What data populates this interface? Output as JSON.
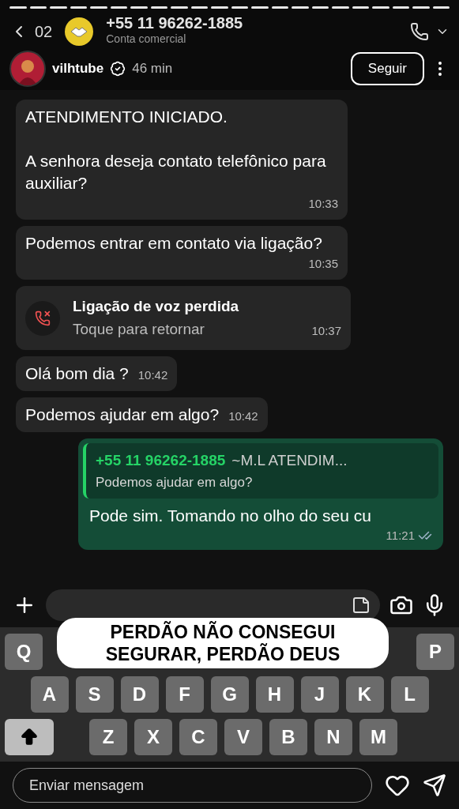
{
  "story": {
    "username": "vilhtube",
    "verified": true,
    "time": "46 min",
    "follow_button": "Seguir",
    "caption": "PERDÃO NÃO CONSEGUI SEGURAR, PERDÃO DEUS",
    "reply_placeholder": "Enviar mensagem"
  },
  "chat_header": {
    "back_count": "02",
    "title": "+55 11 96262-1885",
    "subtitle": "Conta comercial"
  },
  "messages": [
    {
      "kind": "text",
      "outgoing": false,
      "text": "ATENDIMENTO INICIADO.\n\nA senhora deseja contato telefônico para auxiliar?",
      "time": "10:33"
    },
    {
      "kind": "text",
      "outgoing": false,
      "text": "Podemos entrar em contato via ligação?",
      "time": "10:35"
    },
    {
      "kind": "missed_call",
      "outgoing": false,
      "title": "Ligação de voz perdida",
      "subtitle": "Toque para retornar",
      "time": "10:37"
    },
    {
      "kind": "text",
      "outgoing": false,
      "text": "Olá bom dia ?",
      "time": "10:42"
    },
    {
      "kind": "text",
      "outgoing": false,
      "text": "Podemos ajudar em algo?",
      "time": "10:42"
    },
    {
      "kind": "reply",
      "outgoing": true,
      "quote_author": "+55 11 96262-1885",
      "quote_name": "~M.L ATENDIM...",
      "quote_text": "Podemos ajudar em algo?",
      "text": "Pode sim. Tomando no olho do seu cu",
      "time": "11:21",
      "read": true
    }
  ],
  "keyboard": {
    "rows": [
      [
        "Q",
        "P"
      ],
      [
        "A",
        "S",
        "D",
        "F",
        "G",
        "H",
        "J",
        "K",
        "L"
      ],
      [
        "Z",
        "X",
        "C",
        "V",
        "B",
        "N",
        "M"
      ]
    ]
  }
}
